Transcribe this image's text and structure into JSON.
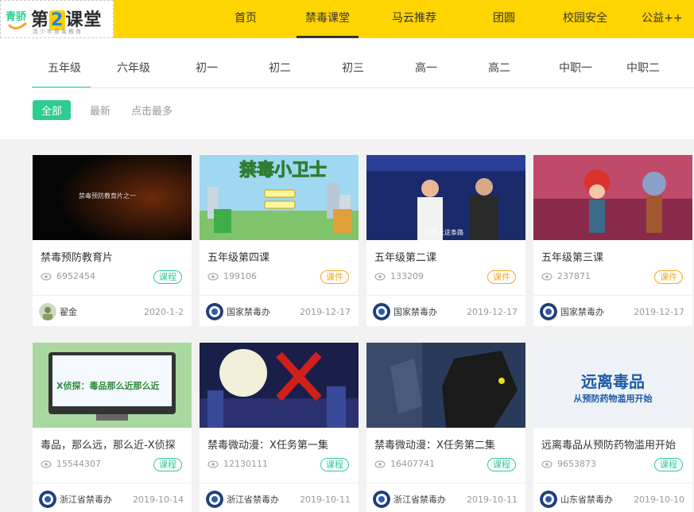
{
  "header": {
    "brand_main": "第",
    "brand_two": "2",
    "brand_rest": "课堂",
    "brand_side": "青骄",
    "slogan": "青少年禁毒教育",
    "nav": [
      {
        "label": "首页"
      },
      {
        "label": "禁毒课堂"
      },
      {
        "label": "马云推荐"
      },
      {
        "label": "团圆"
      },
      {
        "label": "校园安全"
      },
      {
        "label": "公益++"
      }
    ],
    "accent": "#ffd400"
  },
  "grades": [
    "五年级",
    "六年级",
    "初一",
    "初二",
    "初三",
    "高一",
    "高二",
    "中职一",
    "中职二"
  ],
  "filters": [
    "全部",
    "最新",
    "点击最多"
  ],
  "colors": {
    "green": "#2ecc8f",
    "orange": "#f5a623"
  },
  "cards": [
    {
      "title": "禁毒预防教育片",
      "thumb_text": "禁毒预防教育片之一",
      "views": "6952454",
      "tag": "课程",
      "author": "翟金",
      "date": "2020-1-2"
    },
    {
      "title": "五年级第四课",
      "thumb_text": "禁毒小卫士",
      "views": "199106",
      "tag": "课件",
      "author": "国家禁毒办",
      "date": "2019-12-17"
    },
    {
      "title": "五年级第二课",
      "thumb_text": "别踏上这条路",
      "views": "133209",
      "tag": "课件",
      "author": "国家禁毒办",
      "date": "2019-12-17"
    },
    {
      "title": "五年级第三课",
      "views": "237871",
      "tag": "课件",
      "author": "国家禁毒办",
      "date": "2019-12-17"
    },
    {
      "title": "毒品，那么远，那么近-X侦探",
      "thumb_text": "X侦探：毒品那么近那么近",
      "views": "15544307",
      "tag": "课程",
      "author": "浙江省禁毒办",
      "date": "2019-10-14"
    },
    {
      "title": "禁毒微动漫：X任务第一集",
      "views": "12130111",
      "tag": "课程",
      "author": "浙江省禁毒办",
      "date": "2019-10-11"
    },
    {
      "title": "禁毒微动漫：X任务第二集",
      "views": "16407741",
      "tag": "课程",
      "author": "浙江省禁毒办",
      "date": "2019-10-11"
    },
    {
      "title": "远离毒品从预防药物滥用开始",
      "thumb_text": "远离毒品",
      "thumb_sub": "从预防药物滥用开始",
      "views": "9653873",
      "tag": "课程",
      "author": "山东省禁毒办",
      "date": "2019-10-10"
    }
  ]
}
